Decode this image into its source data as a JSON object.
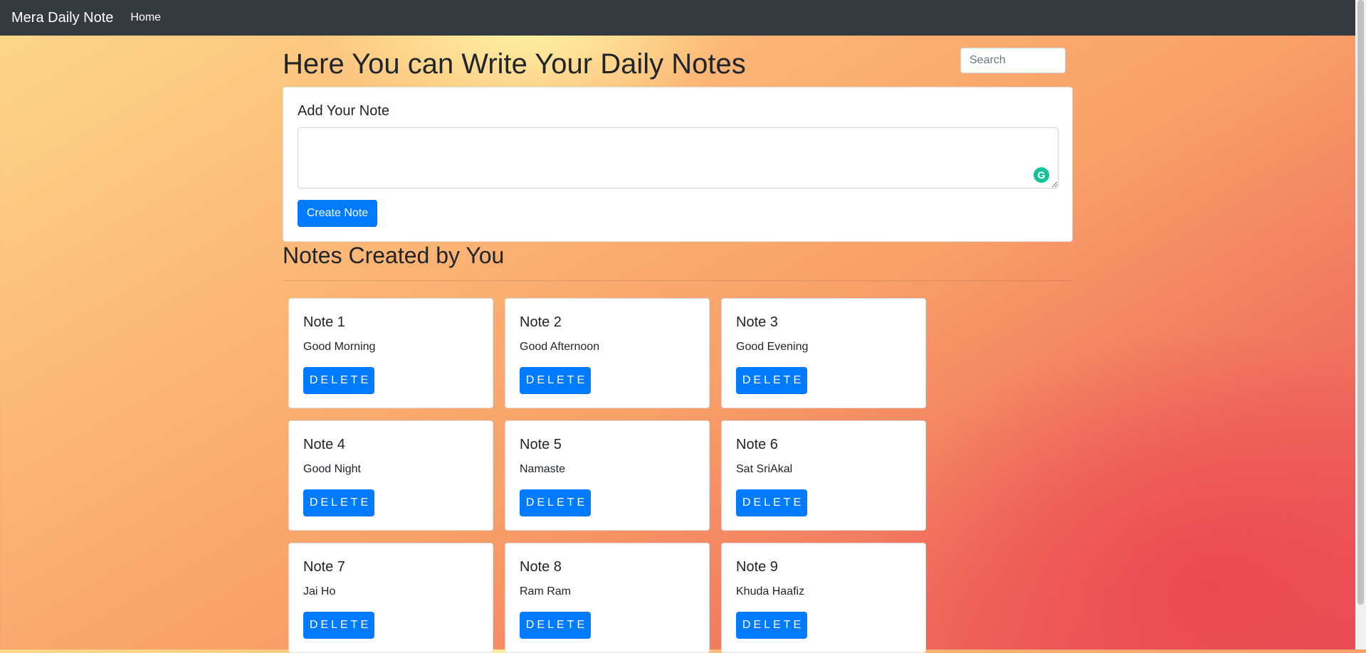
{
  "navbar": {
    "brand": "Mera Daily Note",
    "home_label": "Home"
  },
  "search": {
    "placeholder": "Search"
  },
  "header": {
    "title": "Here You can Write Your Daily Notes"
  },
  "add_note": {
    "title": "Add Your Note",
    "button_label": "Create Note",
    "textarea_value": ""
  },
  "notes_section": {
    "title": "Notes Created by You"
  },
  "notes": [
    {
      "title": "Note 1",
      "text": "Good Morning",
      "delete_label": "DELETE"
    },
    {
      "title": "Note 2",
      "text": "Good Afternoon",
      "delete_label": "DELETE"
    },
    {
      "title": "Note 3",
      "text": "Good Evening",
      "delete_label": "DELETE"
    },
    {
      "title": "Note 4",
      "text": "Good Night",
      "delete_label": "DELETE"
    },
    {
      "title": "Note 5",
      "text": "Namaste",
      "delete_label": "DELETE"
    },
    {
      "title": "Note 6",
      "text": "Sat SriAkal",
      "delete_label": "DELETE"
    },
    {
      "title": "Note 7",
      "text": "Jai Ho",
      "delete_label": "DELETE"
    },
    {
      "title": "Note 8",
      "text": "Ram Ram",
      "delete_label": "DELETE"
    },
    {
      "title": "Note 9",
      "text": "Khuda Haafiz",
      "delete_label": "DELETE"
    }
  ],
  "icons": {
    "grammarly": "grammarly-icon"
  },
  "colors": {
    "navbar": "#343a40",
    "primary": "#007bff",
    "grammarly": "#15c39a"
  }
}
